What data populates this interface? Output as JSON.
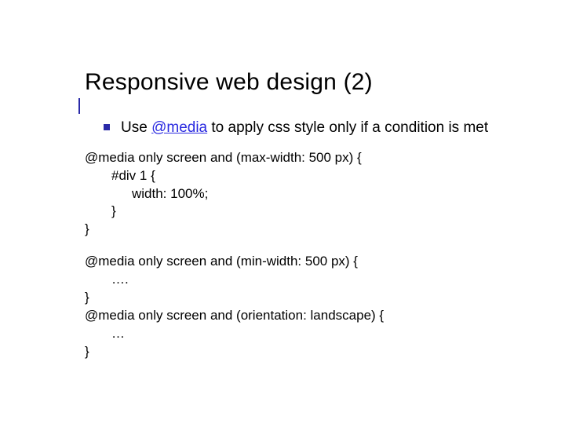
{
  "title": "Responsive web design (2)",
  "bullet": {
    "pre": "Use ",
    "link": "@media",
    "post": " to apply css style only if a condition is met"
  },
  "code1": {
    "l1": "@media only screen and (max-width: 500 px) {",
    "l2": "#div 1 {",
    "l3": "width: 100%;",
    "l4": "}",
    "l5": "}"
  },
  "code2": {
    "l1": "@media only screen and (min-width: 500 px) {",
    "l2": "….",
    "l3": "}",
    "l4": "@media only screen and (orientation: landscape) {",
    "l5": "…",
    "l6": "}"
  }
}
